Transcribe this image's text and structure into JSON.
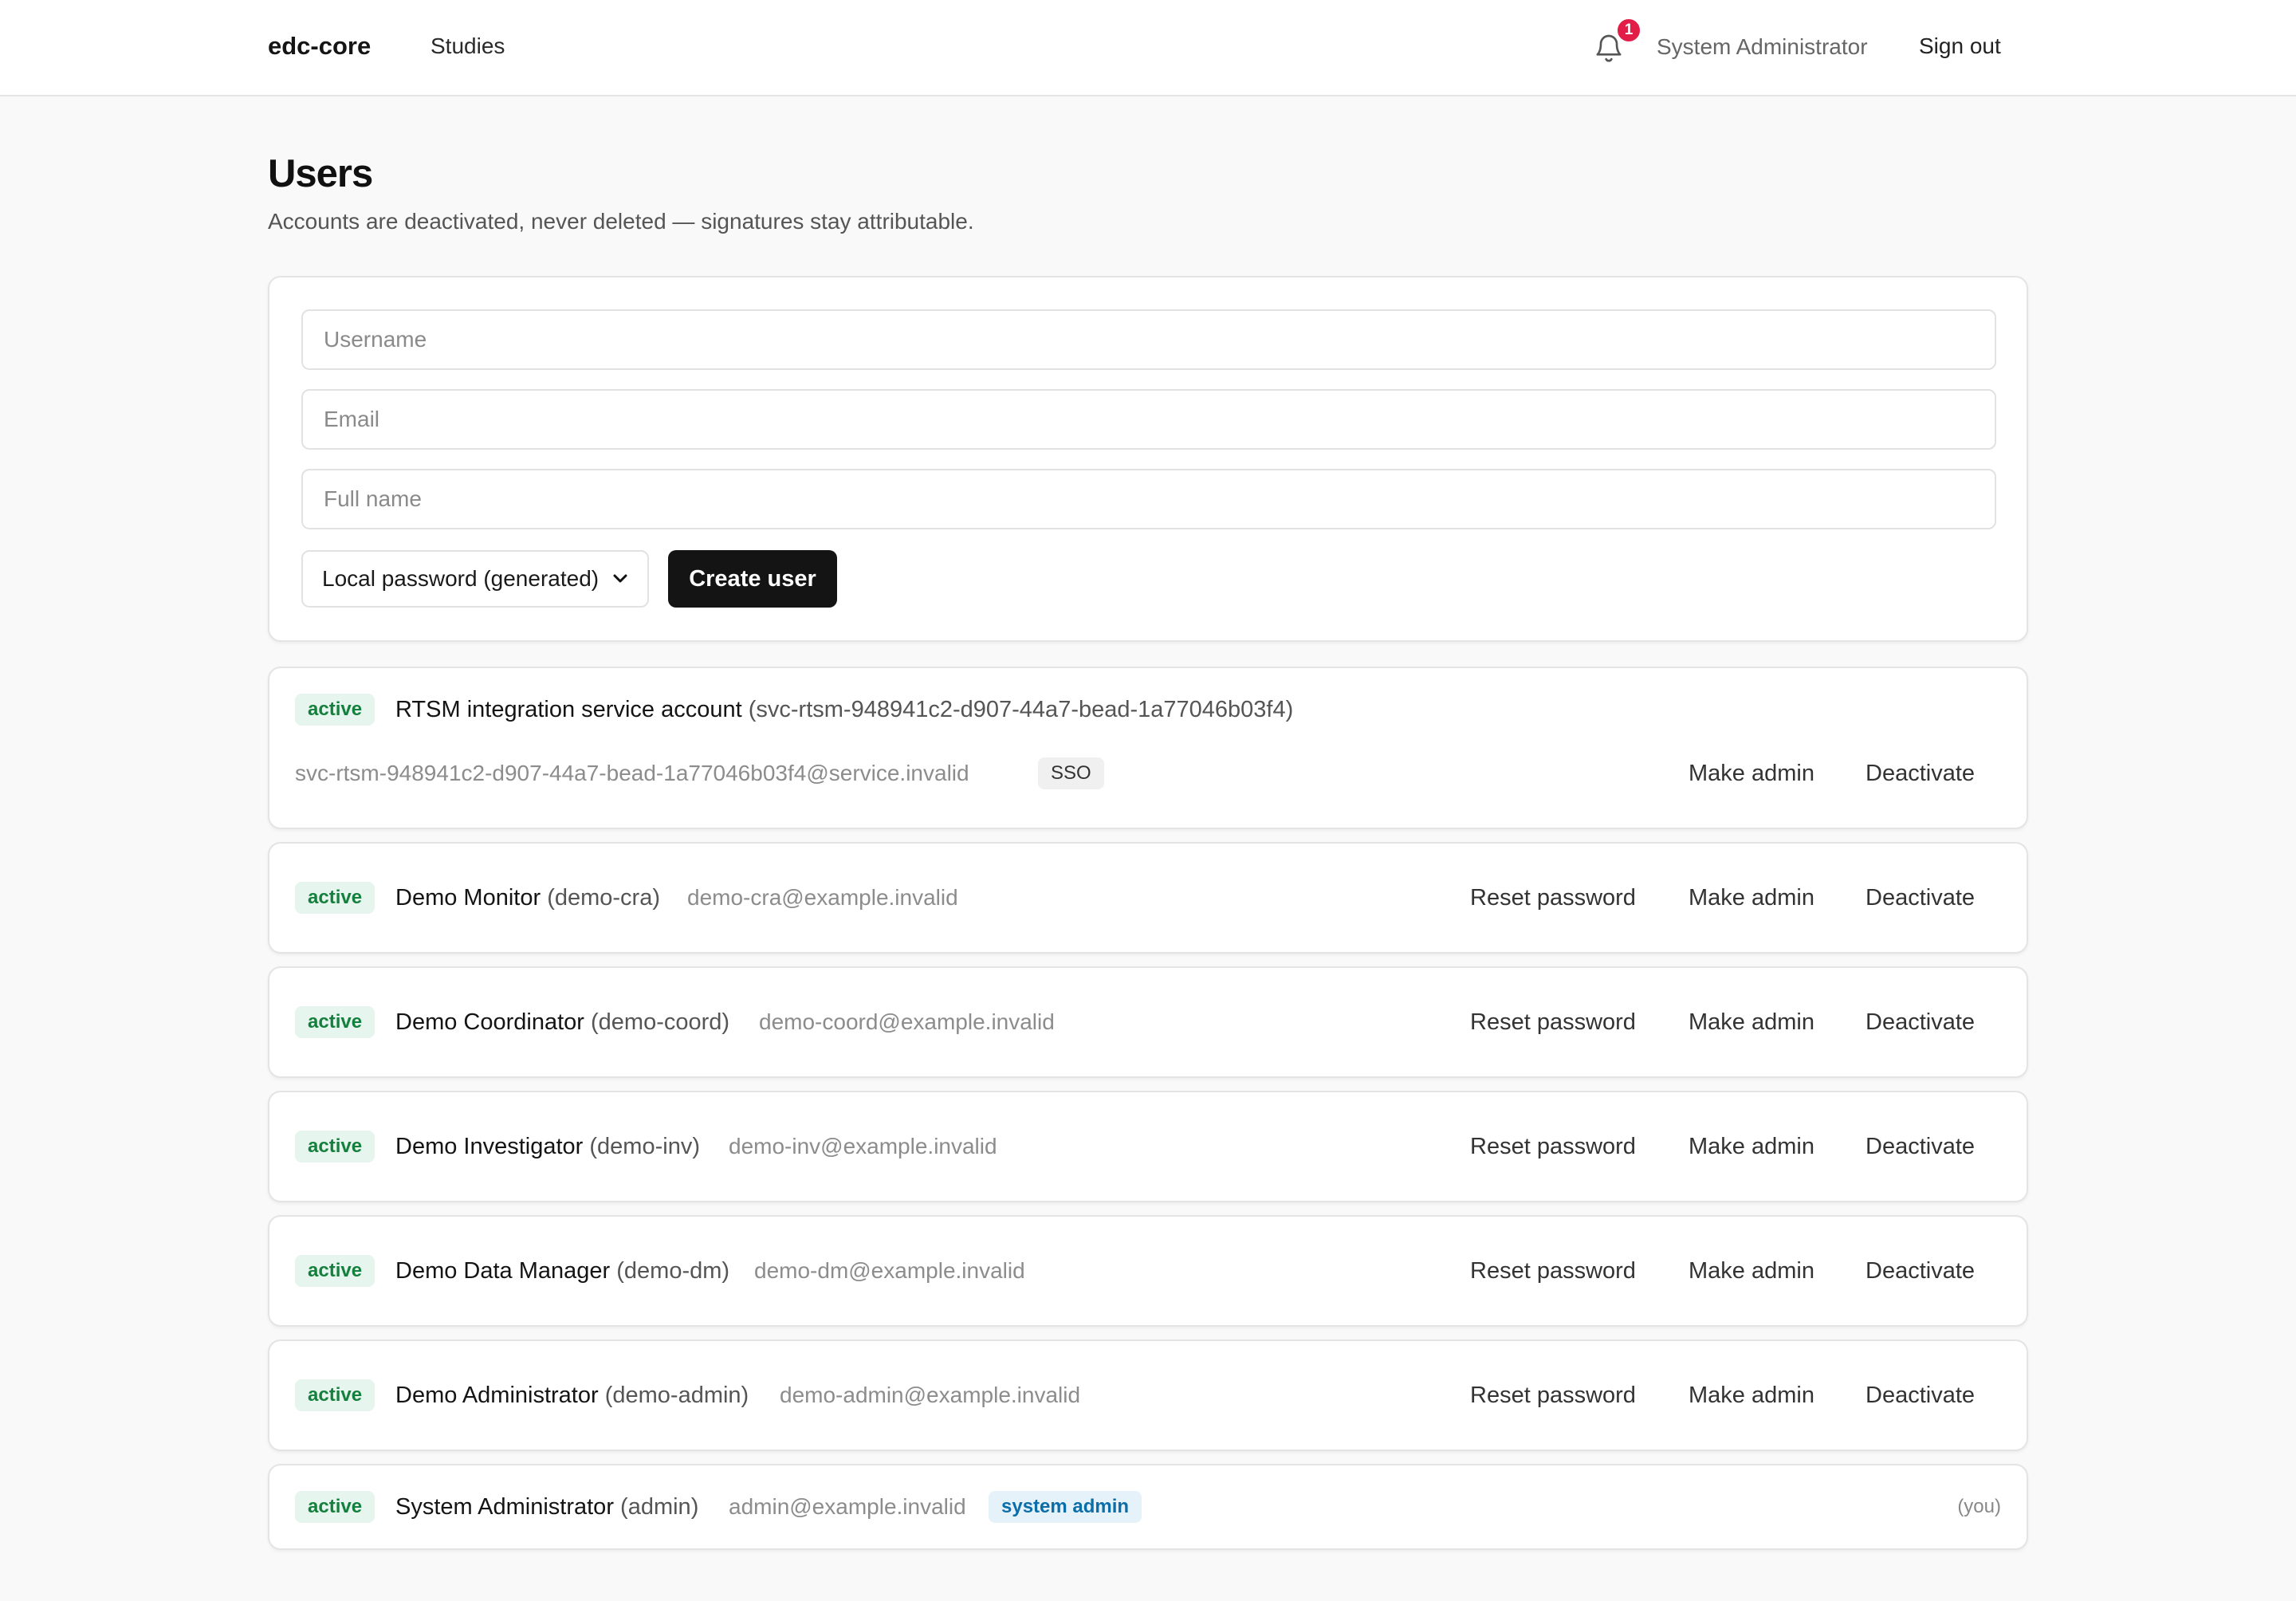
{
  "nav": {
    "brand": "edc-core",
    "studies_link": "Studies",
    "notification_count": "1",
    "current_user": "System Administrator",
    "sign_out": "Sign out"
  },
  "header": {
    "title": "Users",
    "subtitle": "Accounts are deactivated, never deleted — signatures stay attributable."
  },
  "create_form": {
    "username_placeholder": "Username",
    "email_placeholder": "Email",
    "full_name_placeholder": "Full name",
    "auth_method_selected": "Local password (generated)",
    "create_button": "Create user"
  },
  "users": [
    {
      "status": "active",
      "full_name": "RTSM integration service account",
      "username": "(svc-rtsm-948941c2-d907-44a7-bead-1a77046b03f4)",
      "email": "svc-rtsm-948941c2-d907-44a7-bead-1a77046b03f4@service.invalid",
      "tag": "SSO",
      "actions": [
        "Make admin",
        "Deactivate"
      ]
    },
    {
      "status": "active",
      "full_name": "Demo Monitor",
      "username": "(demo-cra)",
      "email": "demo-cra@example.invalid",
      "actions": [
        "Reset password",
        "Make admin",
        "Deactivate"
      ]
    },
    {
      "status": "active",
      "full_name": "Demo Coordinator",
      "username": "(demo-coord)",
      "email": "demo-coord@example.invalid",
      "actions": [
        "Reset password",
        "Make admin",
        "Deactivate"
      ]
    },
    {
      "status": "active",
      "full_name": "Demo Investigator",
      "username": "(demo-inv)",
      "email": "demo-inv@example.invalid",
      "actions": [
        "Reset password",
        "Make admin",
        "Deactivate"
      ]
    },
    {
      "status": "active",
      "full_name": "Demo Data Manager",
      "username": "(demo-dm)",
      "email": "demo-dm@example.invalid",
      "actions": [
        "Reset password",
        "Make admin",
        "Deactivate"
      ]
    },
    {
      "status": "active",
      "full_name": "Demo Administrator",
      "username": "(demo-admin)",
      "email": "demo-admin@example.invalid",
      "actions": [
        "Reset password",
        "Make admin",
        "Deactivate"
      ]
    },
    {
      "status": "active",
      "full_name": "System Administrator",
      "username": "(admin)",
      "email": "admin@example.invalid",
      "tag": "system admin",
      "you_label": "(you)"
    }
  ],
  "colors": {
    "active_badge_bg": "#e6f6ee",
    "active_badge_text": "#15803d",
    "notification_badge": "#e11d48",
    "primary_button": "#141414",
    "system_admin_tag": "#0b6ea8"
  }
}
